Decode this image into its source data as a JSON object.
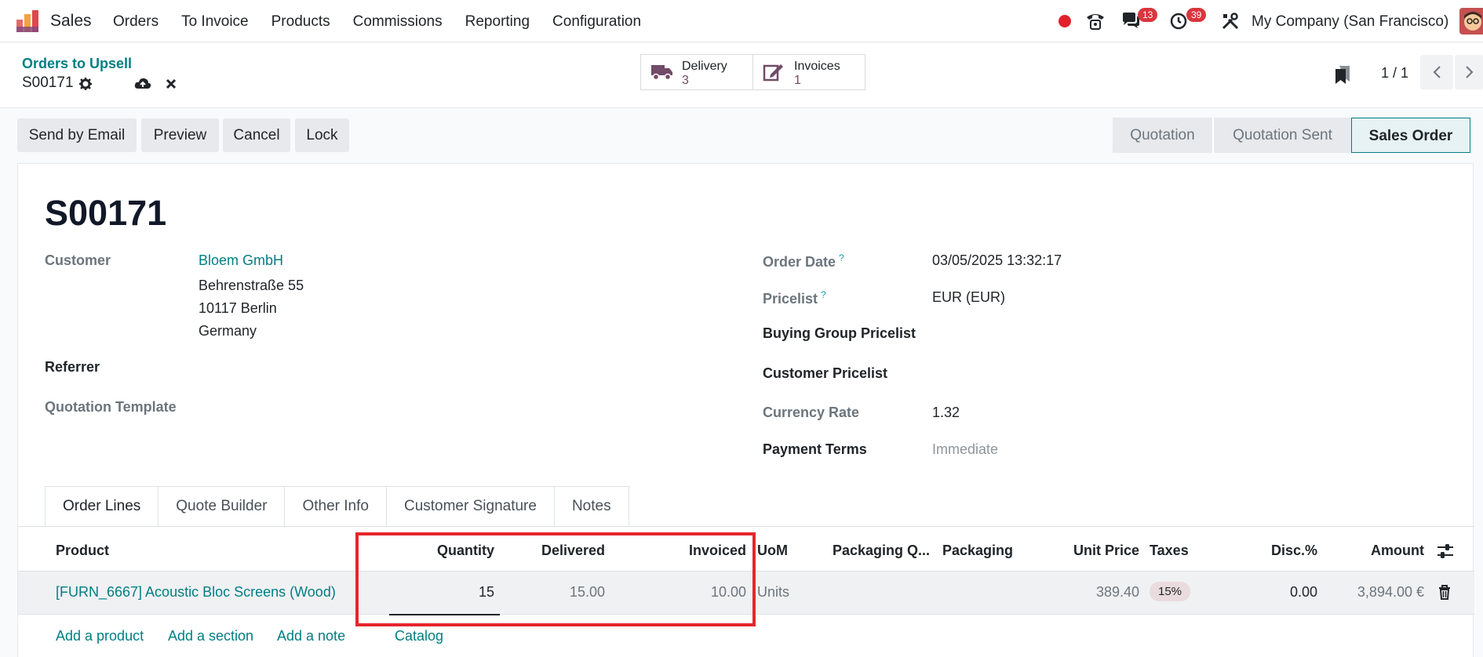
{
  "topbar": {
    "app_name": "Sales",
    "menu": [
      "Orders",
      "To Invoice",
      "Products",
      "Commissions",
      "Reporting",
      "Configuration"
    ],
    "messages_badge": "13",
    "activities_badge": "39",
    "company": "My Company (San Francisco)"
  },
  "controlbar": {
    "breadcrumb_parent": "Orders to Upsell",
    "breadcrumb_current": "S00171",
    "smart_buttons": [
      {
        "label": "Delivery",
        "value": "3"
      },
      {
        "label": "Invoices",
        "value": "1"
      }
    ],
    "pager": "1 / 1"
  },
  "actions": [
    "Send by Email",
    "Preview",
    "Cancel",
    "Lock"
  ],
  "status_stages": [
    "Quotation",
    "Quotation Sent",
    "Sales Order"
  ],
  "active_stage": "Sales Order",
  "form": {
    "title": "S00171",
    "customer_label": "Customer",
    "customer_name": "Bloem GmbH",
    "address_lines": [
      "Behrenstraße 55",
      "10117 Berlin",
      "Germany"
    ],
    "referrer_label": "Referrer",
    "quotation_template_label": "Quotation Template",
    "order_date_label": "Order Date",
    "order_date": "03/05/2025 13:32:17",
    "pricelist_label": "Pricelist",
    "pricelist": "EUR (EUR)",
    "buying_group_label": "Buying Group Pricelist",
    "customer_pricelist_label": "Customer Pricelist",
    "currency_rate_label": "Currency Rate",
    "currency_rate": "1.32",
    "payment_terms_label": "Payment Terms",
    "payment_terms": "Immediate"
  },
  "tabs": [
    "Order Lines",
    "Quote Builder",
    "Other Info",
    "Customer Signature",
    "Notes"
  ],
  "table": {
    "headers": {
      "product": "Product",
      "quantity": "Quantity",
      "delivered": "Delivered",
      "invoiced": "Invoiced",
      "uom": "UoM",
      "packaging_qty": "Packaging Q...",
      "packaging": "Packaging",
      "unit_price": "Unit Price",
      "taxes": "Taxes",
      "discount": "Disc.%",
      "amount": "Amount"
    },
    "row": {
      "product": "[FURN_6667] Acoustic Bloc Screens (Wood)",
      "quantity": "15",
      "delivered": "15.00",
      "invoiced": "10.00",
      "uom": "Units",
      "unit_price": "389.40",
      "tax": "15%",
      "discount": "0.00",
      "amount": "3,894.00 €"
    },
    "add_links": [
      "Add a product",
      "Add a section",
      "Add a note",
      "Catalog"
    ]
  },
  "colors": {
    "accent": "#017e84",
    "brand": "#714b67",
    "highlight": "#e5262c"
  }
}
